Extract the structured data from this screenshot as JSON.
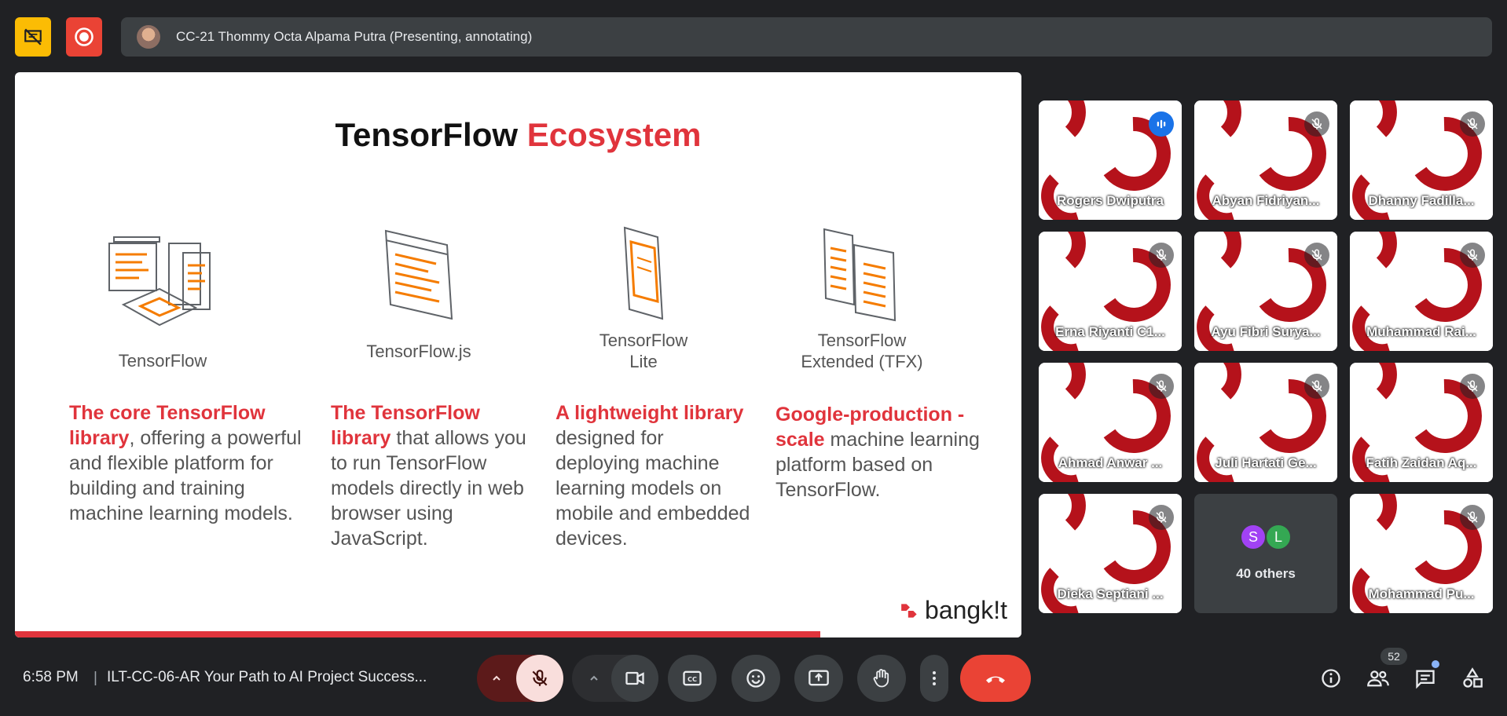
{
  "top": {
    "presenter_label": "CC-21 Thommy Octa Alpama Putra (Presenting, annotating)"
  },
  "slide": {
    "title_main": "TensorFlow",
    "title_accent": "Ecosystem",
    "columns": [
      {
        "label": "TensorFlow",
        "desc_hl": "The core TensorFlow library",
        "desc_rest": ", offering a powerful and flexible platform for building and training machine learning models."
      },
      {
        "label": "TensorFlow.js",
        "desc_hl": "The TensorFlow library",
        "desc_rest": " that allows you to run TensorFlow models directly in web browser using JavaScript."
      },
      {
        "label": "TensorFlow Lite",
        "desc_hl": "A lightweight library",
        "desc_rest": " designed for deploying machine learning models on mobile and embedded devices."
      },
      {
        "label": "TensorFlow Extended (TFX)",
        "desc_hl": "Google-production -scale",
        "desc_rest": " machine learning platform based on TensorFlow."
      }
    ],
    "brand": "bangk!t",
    "progress": 0.8
  },
  "participants": [
    {
      "name": "Rogers Dwiputra",
      "speaking": true
    },
    {
      "name": "Abyan Fidriyan..."
    },
    {
      "name": "Dhanny Fadilla..."
    },
    {
      "name": "Erna Riyanti C1..."
    },
    {
      "name": "Ayu Fibri Surya..."
    },
    {
      "name": "Muhammad Rai..."
    },
    {
      "name": "Ahmad Anwar ..."
    },
    {
      "name": "Juli Hartati Ge..."
    },
    {
      "name": "Fatih Zaidan Aq..."
    },
    {
      "name": "Dieka Septiani ..."
    },
    {
      "name": "Mohammad Pu..."
    }
  ],
  "others": {
    "label": "40 others",
    "initials": [
      "S",
      "L"
    ],
    "colors": [
      "#a142f4",
      "#34a853"
    ]
  },
  "bottom": {
    "time": "6:58 PM",
    "meeting": "ILT-CC-06-AR Your Path to AI Project Success...",
    "people_count": "52"
  },
  "colors": {
    "accent": "#e0343c",
    "end_call": "#ea4335",
    "active_border": "#8ab4f8"
  }
}
